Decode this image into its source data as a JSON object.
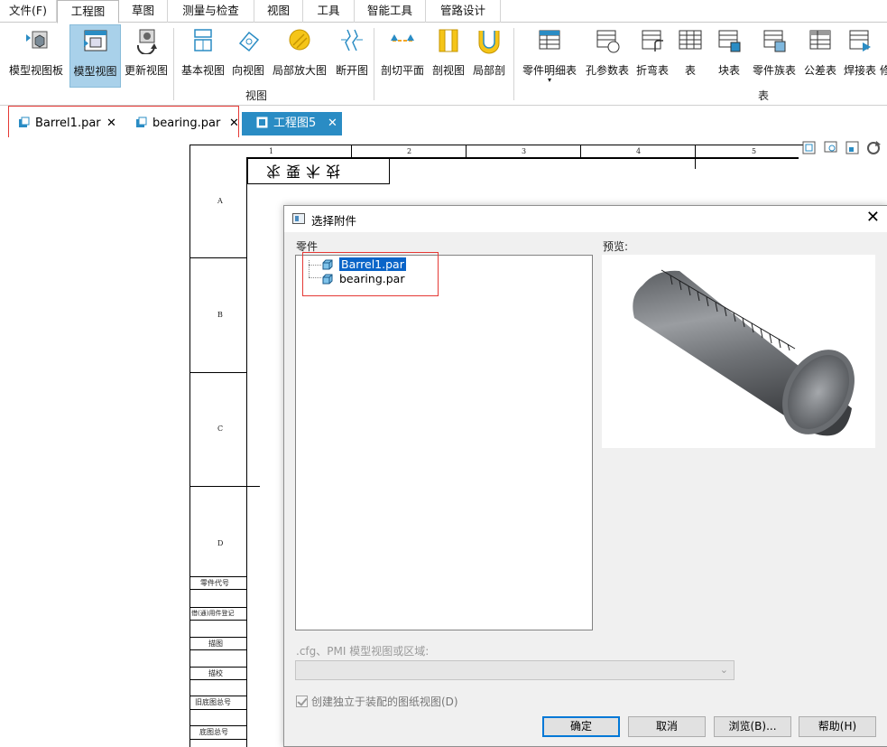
{
  "menu": {
    "items": [
      "文件(F)",
      "工程图",
      "草图",
      "测量与检查",
      "视图",
      "工具",
      "智能工具",
      "管路设计"
    ]
  },
  "ribbon": {
    "view_group": {
      "label": "视图",
      "buttons": [
        "模型视图板",
        "模型视图",
        "更新视图",
        "基本视图",
        "向视图",
        "局部放大图",
        "断开图",
        "剖切平面",
        "剖视图",
        "局部剖"
      ]
    },
    "table_group": {
      "label": "表",
      "buttons": [
        "零件明细表",
        "孔参数表",
        "折弯表",
        "表",
        "块表",
        "零件族表",
        "公差表",
        "焊接表"
      ],
      "dropdown_glyph": "▾",
      "partial": "修"
    }
  },
  "doc_tabs": [
    {
      "label": "Barrel1.par",
      "close": "✕"
    },
    {
      "label": "bearing.par",
      "close": "✕"
    },
    {
      "label": "工程图5",
      "close": "✕",
      "active": true
    }
  ],
  "drawing": {
    "zone_numbers": [
      "1",
      "2",
      "3",
      "4",
      "5"
    ],
    "zone_letters": [
      "A",
      "B",
      "C",
      "D"
    ],
    "tech_note": "技术要求",
    "side_labels": [
      "零件代号",
      "借(通)用件登记",
      "描图",
      "描校",
      "旧底图总号",
      "底图总号"
    ]
  },
  "dialog": {
    "title": "选择附件",
    "close": "✕",
    "parts_label": "零件",
    "preview_label": "预览:",
    "parts": [
      {
        "name": "Barrel1.par",
        "selected": true
      },
      {
        "name": "bearing.par",
        "selected": false
      }
    ],
    "combo_label": ".cfg、PMI 模型视图或区域:",
    "combo_value": "",
    "checkbox_label": "创建独立于装配的图纸视图(D)",
    "checkbox_checked": true,
    "buttons": {
      "ok": "确定",
      "cancel": "取消",
      "browse": "浏览(B)...",
      "help": "帮助(H)"
    }
  },
  "colors": {
    "accent": "#2a8cc4",
    "selection": "#0a64c8",
    "highlight_box": "#e53935",
    "active_ribbon": "#a9d1ea"
  }
}
